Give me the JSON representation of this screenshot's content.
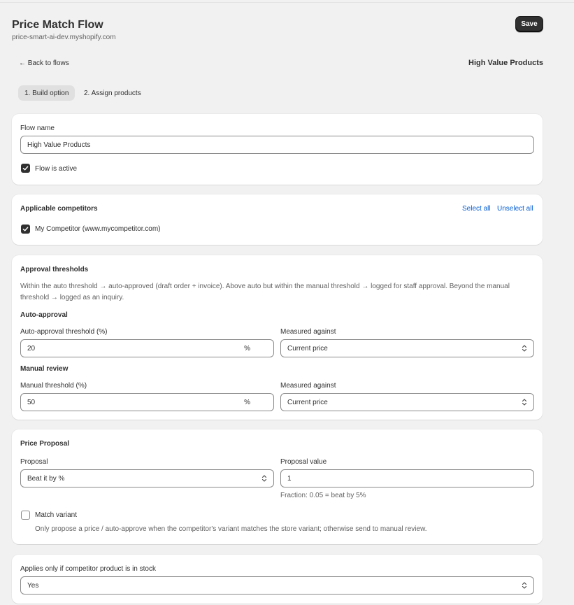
{
  "header": {
    "title": "Price Match Flow",
    "subtitle": "price-smart-ai-dev.myshopify.com",
    "save_label": "Save",
    "back_label": "← Back to flows",
    "flow_name_display": "High Value Products"
  },
  "tabs": [
    {
      "label": "1. Build option",
      "active": true
    },
    {
      "label": "2. Assign products",
      "active": false
    }
  ],
  "flow_card": {
    "name_label": "Flow name",
    "name_value": "High Value Products",
    "active_label": "Flow is active",
    "active_checked": true
  },
  "competitors_card": {
    "title": "Applicable competitors",
    "select_all": "Select all",
    "unselect_all": "Unselect all",
    "items": [
      {
        "label": "My Competitor (www.mycompetitor.com)",
        "checked": true
      }
    ]
  },
  "thresholds_card": {
    "title": "Approval thresholds",
    "description": "Within the auto threshold → auto-approved (draft order + invoice). Above auto but within the manual threshold → logged for staff approval. Beyond the manual threshold → logged as an inquiry.",
    "auto": {
      "section_title": "Auto-approval",
      "threshold_label": "Auto-approval threshold (%)",
      "threshold_value": "20",
      "suffix": "%",
      "measured_label": "Measured against",
      "measured_value": "Current price"
    },
    "manual": {
      "section_title": "Manual review",
      "threshold_label": "Manual threshold (%)",
      "threshold_value": "50",
      "suffix": "%",
      "measured_label": "Measured against",
      "measured_value": "Current price"
    }
  },
  "proposal_card": {
    "title": "Price Proposal",
    "proposal_label": "Proposal",
    "proposal_value": "Beat it by %",
    "value_label": "Proposal value",
    "value_value": "1",
    "value_help": "Fraction: 0.05 = beat by 5%",
    "match_variant_label": "Match variant",
    "match_variant_checked": false,
    "match_variant_help": "Only propose a price / auto-approve when the competitor's variant matches the store variant; otherwise send to manual review."
  },
  "stock_card": {
    "label": "Applies only if competitor product is in stock",
    "value": "Yes"
  },
  "icons": {
    "check": "checkmark-icon",
    "select": "select-chevron-icon"
  },
  "colors": {
    "primary_button": "#303030",
    "link": "#005bd3",
    "background": "#f1f1f1"
  }
}
